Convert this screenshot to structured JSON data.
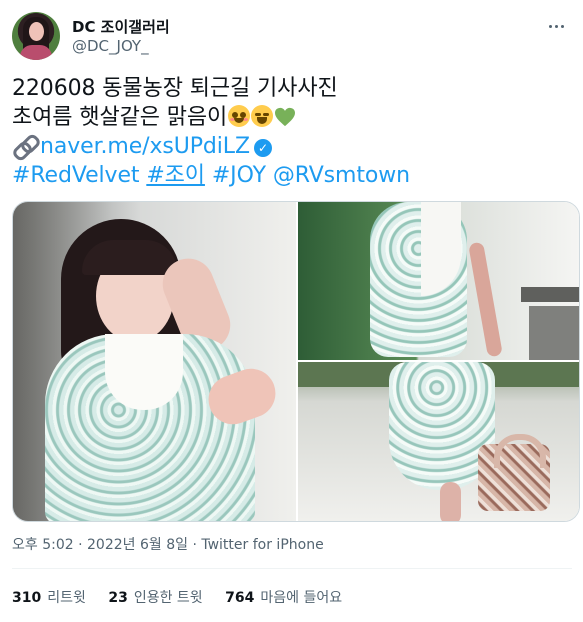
{
  "author": {
    "display_name": "DC 조이갤러리",
    "handle": "@DC_JOY_"
  },
  "tweet": {
    "line1": "220608 동물농장 퇴근길 기사사진",
    "line2": "초여름 햇살같은 맑음이",
    "link_text": "naver.me/xsUPdiLZ",
    "hashtags": [
      "#RedVelvet",
      "#조이",
      "#JOY",
      "@RVsmtown"
    ]
  },
  "meta": {
    "time": "오후 5:02",
    "date": "2022년 6월 8일",
    "separator": "·",
    "source": "Twitter for iPhone"
  },
  "stats": {
    "retweets_count": "310",
    "retweets_label": "리트윗",
    "quotes_count": "23",
    "quotes_label": "인용한 트윗",
    "likes_count": "764",
    "likes_label": "마음에 들어요"
  },
  "icons": {
    "more": "more-icon",
    "link": "link-icon",
    "verified": "verified-icon"
  },
  "colors": {
    "accent": "#1d9bf0",
    "secondary_text": "#536471",
    "emoji_heart": "#78b159"
  }
}
